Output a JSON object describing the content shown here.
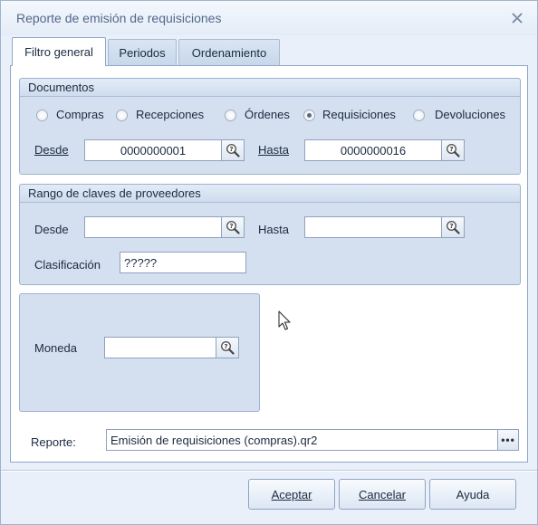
{
  "window": {
    "title": "Reporte de emisión de requisiciones"
  },
  "tabs": [
    {
      "label": "Filtro general",
      "active": true
    },
    {
      "label": "Periodos",
      "active": false
    },
    {
      "label": "Ordenamiento",
      "active": false
    }
  ],
  "documentos": {
    "title": "Documentos",
    "radios": [
      {
        "label": "Compras",
        "checked": false
      },
      {
        "label": "Recepciones",
        "checked": false
      },
      {
        "label": "Órdenes",
        "checked": false
      },
      {
        "label": "Requisiciones",
        "checked": true
      },
      {
        "label": "Devoluciones",
        "checked": false
      }
    ],
    "desde_label": "Desde",
    "desde_value": "0000000001",
    "hasta_label": "Hasta",
    "hasta_value": "0000000016"
  },
  "proveedores": {
    "title": "Rango de claves de proveedores",
    "desde_label": "Desde",
    "desde_value": "",
    "hasta_label": "Hasta",
    "hasta_value": "",
    "clasificacion_label": "Clasificación",
    "clasificacion_value": "?????"
  },
  "moneda": {
    "label": "Moneda",
    "value": ""
  },
  "reporte": {
    "label": "Reporte:",
    "value": "Emisión de requisiciones (compras).qr2"
  },
  "buttons": {
    "accept": "Aceptar",
    "cancel": "Cancelar",
    "help": "Ayuda"
  },
  "icons": {
    "close": "close-icon",
    "lookup": "magnifier-question-icon",
    "browse": "ellipsis-icon",
    "cursor": "mouse-pointer-icon"
  }
}
